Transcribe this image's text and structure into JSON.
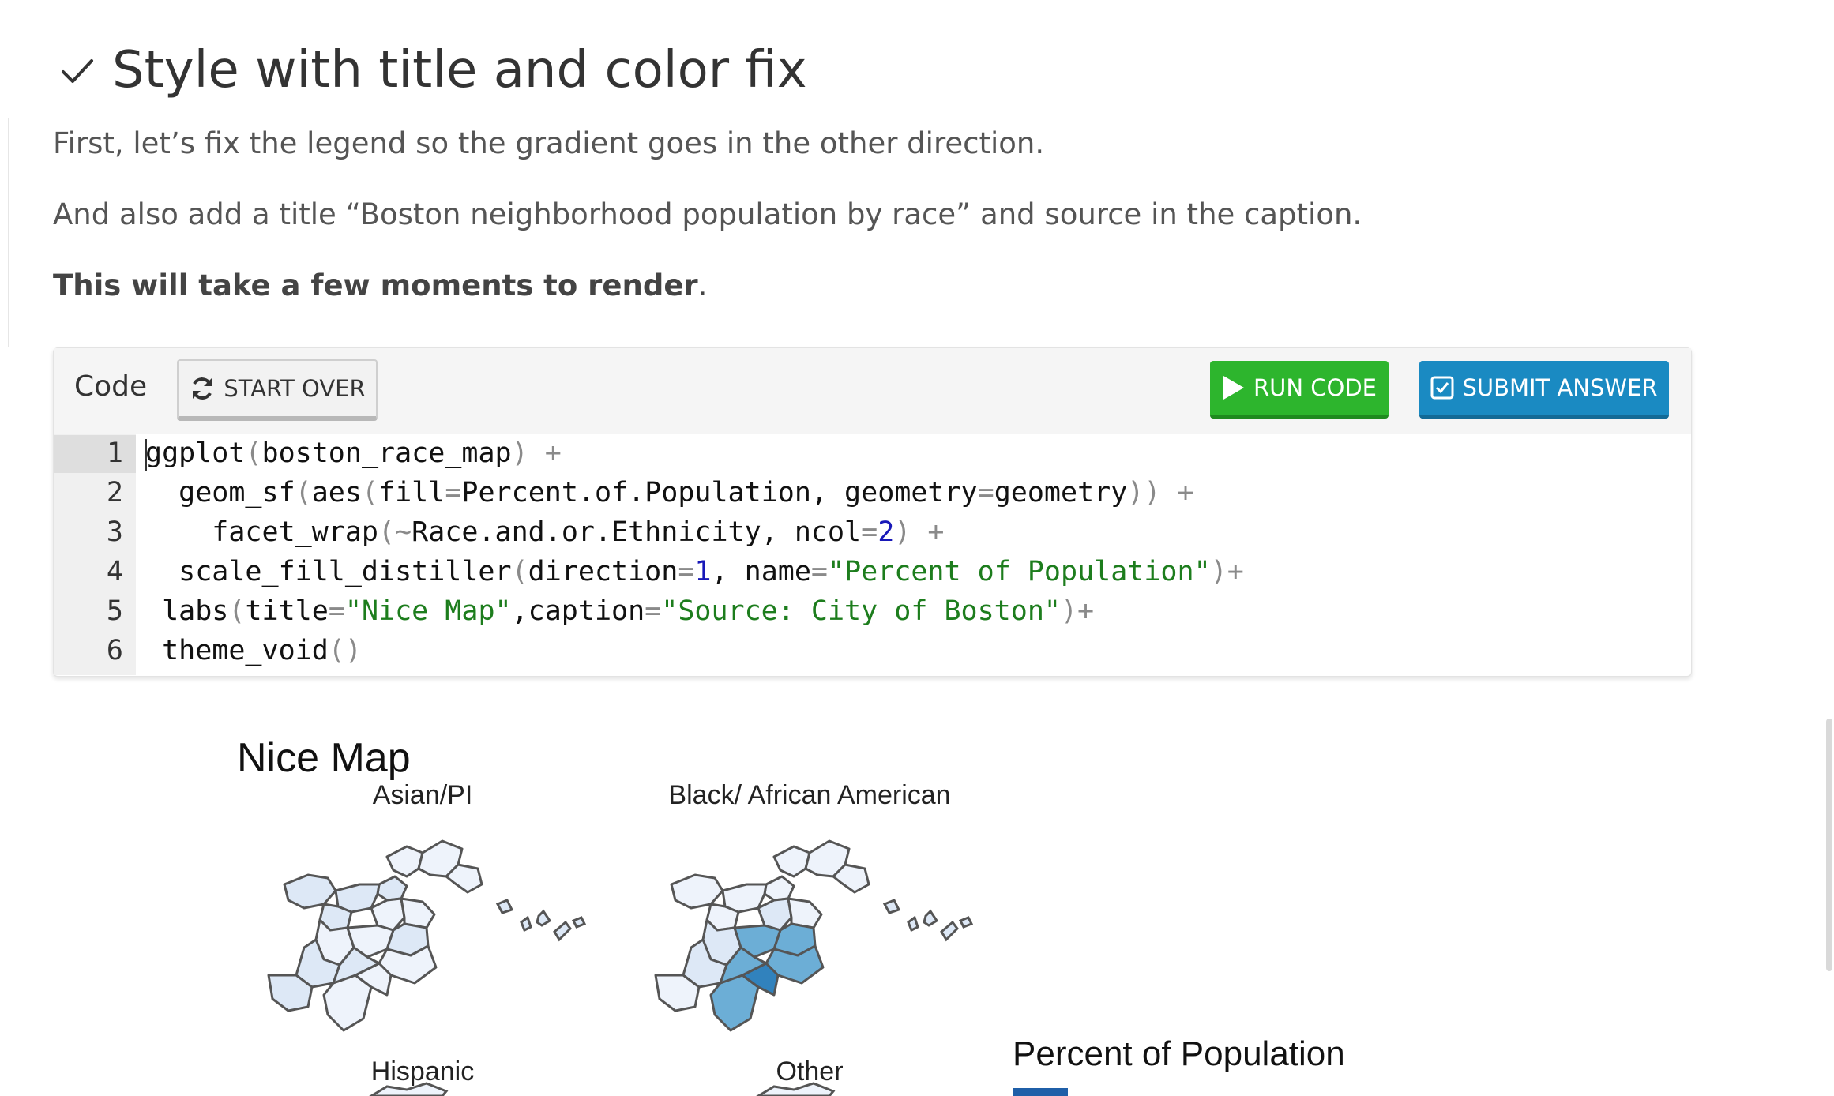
{
  "section": {
    "title": "Style with title and color fix",
    "paragraphs": [
      "First, let’s fix the legend so the gradient goes in the other direction.",
      "And also add a title “Boston neighborhood population by race” and source in the caption."
    ],
    "note_bold": "This will take a few moments to render",
    "note_tail": "."
  },
  "code_panel": {
    "label": "Code",
    "start_over_label": "START OVER",
    "run_label": "RUN CODE",
    "submit_label": "SUBMIT ANSWER",
    "line_numbers": [
      "1",
      "2",
      "3",
      "4",
      "5",
      "6"
    ],
    "lines": [
      [
        {
          "t": "ggplot",
          "c": "default"
        },
        {
          "t": "(",
          "c": "punct"
        },
        {
          "t": "boston_race_map",
          "c": "default"
        },
        {
          "t": ")",
          "c": "punct"
        },
        {
          "t": " +",
          "c": "punct"
        }
      ],
      [
        {
          "t": "  geom_sf",
          "c": "default"
        },
        {
          "t": "(",
          "c": "punct"
        },
        {
          "t": "aes",
          "c": "default"
        },
        {
          "t": "(",
          "c": "punct"
        },
        {
          "t": "fill",
          "c": "default"
        },
        {
          "t": "=",
          "c": "punct"
        },
        {
          "t": "Percent.of.Population, geometry",
          "c": "default"
        },
        {
          "t": "=",
          "c": "punct"
        },
        {
          "t": "geometry",
          "c": "default"
        },
        {
          "t": ")) +",
          "c": "punct"
        }
      ],
      [
        {
          "t": "    facet_wrap",
          "c": "default"
        },
        {
          "t": "(~",
          "c": "punct"
        },
        {
          "t": "Race.and.or.Ethnicity, ncol",
          "c": "default"
        },
        {
          "t": "=",
          "c": "punct"
        },
        {
          "t": "2",
          "c": "number"
        },
        {
          "t": ") +",
          "c": "punct"
        }
      ],
      [
        {
          "t": "  scale_fill_distiller",
          "c": "default"
        },
        {
          "t": "(",
          "c": "punct"
        },
        {
          "t": "direction",
          "c": "default"
        },
        {
          "t": "=",
          "c": "punct"
        },
        {
          "t": "1",
          "c": "number"
        },
        {
          "t": ", name",
          "c": "default"
        },
        {
          "t": "=",
          "c": "punct"
        },
        {
          "t": "\"Percent of Population\"",
          "c": "string"
        },
        {
          "t": ")+",
          "c": "punct"
        }
      ],
      [
        {
          "t": " labs",
          "c": "default"
        },
        {
          "t": "(",
          "c": "punct"
        },
        {
          "t": "title",
          "c": "default"
        },
        {
          "t": "=",
          "c": "punct"
        },
        {
          "t": "\"Nice Map\"",
          "c": "string"
        },
        {
          "t": ",caption",
          "c": "default"
        },
        {
          "t": "=",
          "c": "punct"
        },
        {
          "t": "\"Source: City of Boston\"",
          "c": "string"
        },
        {
          "t": ")+",
          "c": "punct"
        }
      ],
      [
        {
          "t": " theme_void",
          "c": "default"
        },
        {
          "t": "()",
          "c": "punct"
        }
      ]
    ],
    "syntax_colors": {
      "default": "#111111",
      "punct": "#8a8a8a",
      "number": "#1818b8",
      "string": "#1d7d1d"
    }
  },
  "plot": {
    "title": "Nice Map",
    "facets": [
      "Asian/PI",
      "Black/ African American",
      "Hispanic",
      "Other"
    ],
    "legend_title": "Percent of Population",
    "fill_colors": {
      "lightest": "#eef3fb",
      "light": "#dde8f6",
      "mid": "#6caed6",
      "dark": "#3182bd",
      "darkest": "#2171b5",
      "legend_swatch": "#1f5fa8",
      "outline": "#555555"
    }
  },
  "icons": {
    "check": "check-icon",
    "refresh": "refresh-icon",
    "play": "play-icon",
    "checkbox": "checkbox-icon"
  }
}
